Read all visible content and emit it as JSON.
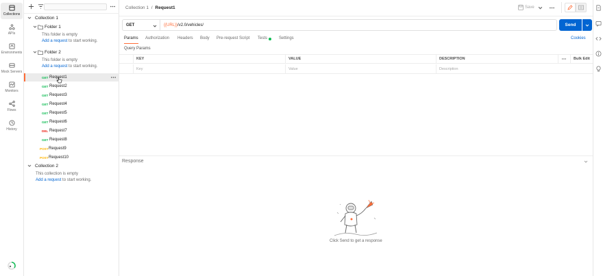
{
  "rail": {
    "items": [
      {
        "label": "Collections",
        "icon": "collections-icon",
        "active": true
      },
      {
        "label": "APIs",
        "icon": "apis-icon"
      },
      {
        "label": "Environments",
        "icon": "environments-icon"
      },
      {
        "label": "Mock Servers",
        "icon": "mock-servers-icon"
      },
      {
        "label": "Monitors",
        "icon": "monitors-icon"
      },
      {
        "label": "Flows",
        "icon": "flows-icon"
      },
      {
        "label": "History",
        "icon": "history-icon"
      }
    ]
  },
  "sidebar": {
    "collection1": "Collection 1",
    "folder1": "Folder 1",
    "folder2": "Folder 2",
    "collection2": "Collection 2",
    "folder_empty_text": "This folder is empty",
    "add_request_link": "Add a request",
    "start_working": " to start working.",
    "collection_empty_text": "This collection is empty",
    "requests": [
      {
        "method": "GET",
        "name": "Request1"
      },
      {
        "method": "GET",
        "name": "Request2"
      },
      {
        "method": "GET",
        "name": "Request3"
      },
      {
        "method": "GET",
        "name": "Request4"
      },
      {
        "method": "GET",
        "name": "Request5"
      },
      {
        "method": "GET",
        "name": "Request6"
      },
      {
        "method": "DEL",
        "name": "Request7"
      },
      {
        "method": "GET",
        "name": "Request8"
      },
      {
        "method": "POST",
        "name": "Request9"
      },
      {
        "method": "POST",
        "name": "Request10"
      }
    ]
  },
  "header": {
    "breadcrumb_parent": "Collection 1",
    "breadcrumb_sep": "/",
    "breadcrumb_current": "Request1",
    "save_label": "Save"
  },
  "request": {
    "method": "GET",
    "url_var": "{{URL}}",
    "url_path": "/v2.0/vehicles/",
    "send_label": "Send",
    "tabs": [
      "Params",
      "Authorization",
      "Headers",
      "Body",
      "Pre-request Script",
      "Tests",
      "Settings"
    ],
    "cookies_label": "Cookies",
    "query_params_label": "Query Params",
    "columns": {
      "key": "KEY",
      "value": "VALUE",
      "description": "DESCRIPTION",
      "bulk_edit": "Bulk Edit"
    },
    "placeholders": {
      "key": "Key",
      "value": "Value",
      "description": "Description"
    }
  },
  "response": {
    "title": "Response",
    "hint": "Click Send to get a response"
  },
  "colors": {
    "accent": "#ff6c37",
    "primary": "#0265d2",
    "get": "#0cbb52",
    "post": "#ffb400",
    "delete": "#eb2013"
  }
}
